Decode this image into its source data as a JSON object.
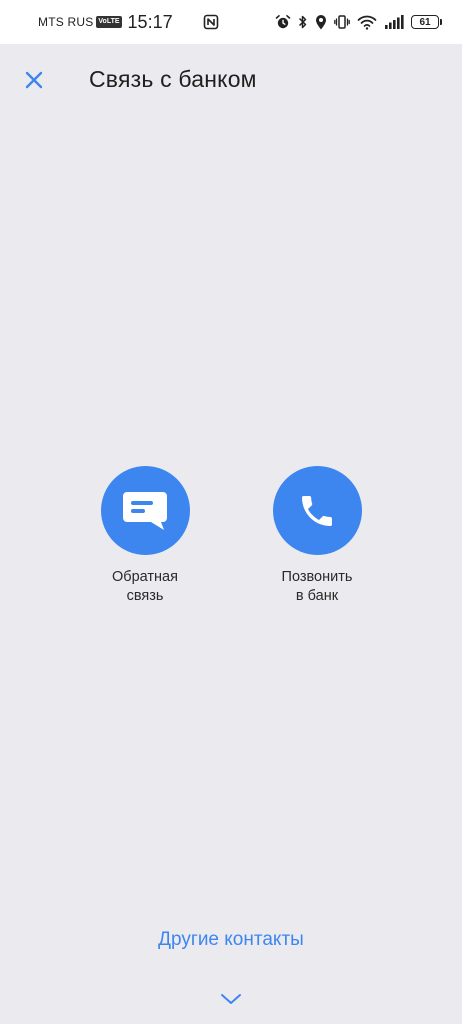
{
  "status_bar": {
    "carrier": "MTS RUS",
    "volte": "VoLTE",
    "time": "15:17",
    "battery_level": "61",
    "icons": [
      "nfc-icon",
      "alarm-icon",
      "bluetooth-icon",
      "location-icon",
      "vibrate-icon",
      "wifi-icon",
      "signal-icon",
      "battery-icon"
    ]
  },
  "header": {
    "title": "Связь с банком",
    "close_icon": "close-icon"
  },
  "actions": [
    {
      "label_line1": "Обратная",
      "label_line2": "связь",
      "icon": "chat-icon"
    },
    {
      "label_line1": "Позвонить",
      "label_line2": "в банк",
      "icon": "phone-icon"
    }
  ],
  "footer": {
    "other_contacts": "Другие контакты",
    "expand_icon": "chevron-down-icon"
  },
  "colors": {
    "accent": "#3d86f0",
    "background": "#ebebef",
    "status_bar": "#ffffff"
  }
}
